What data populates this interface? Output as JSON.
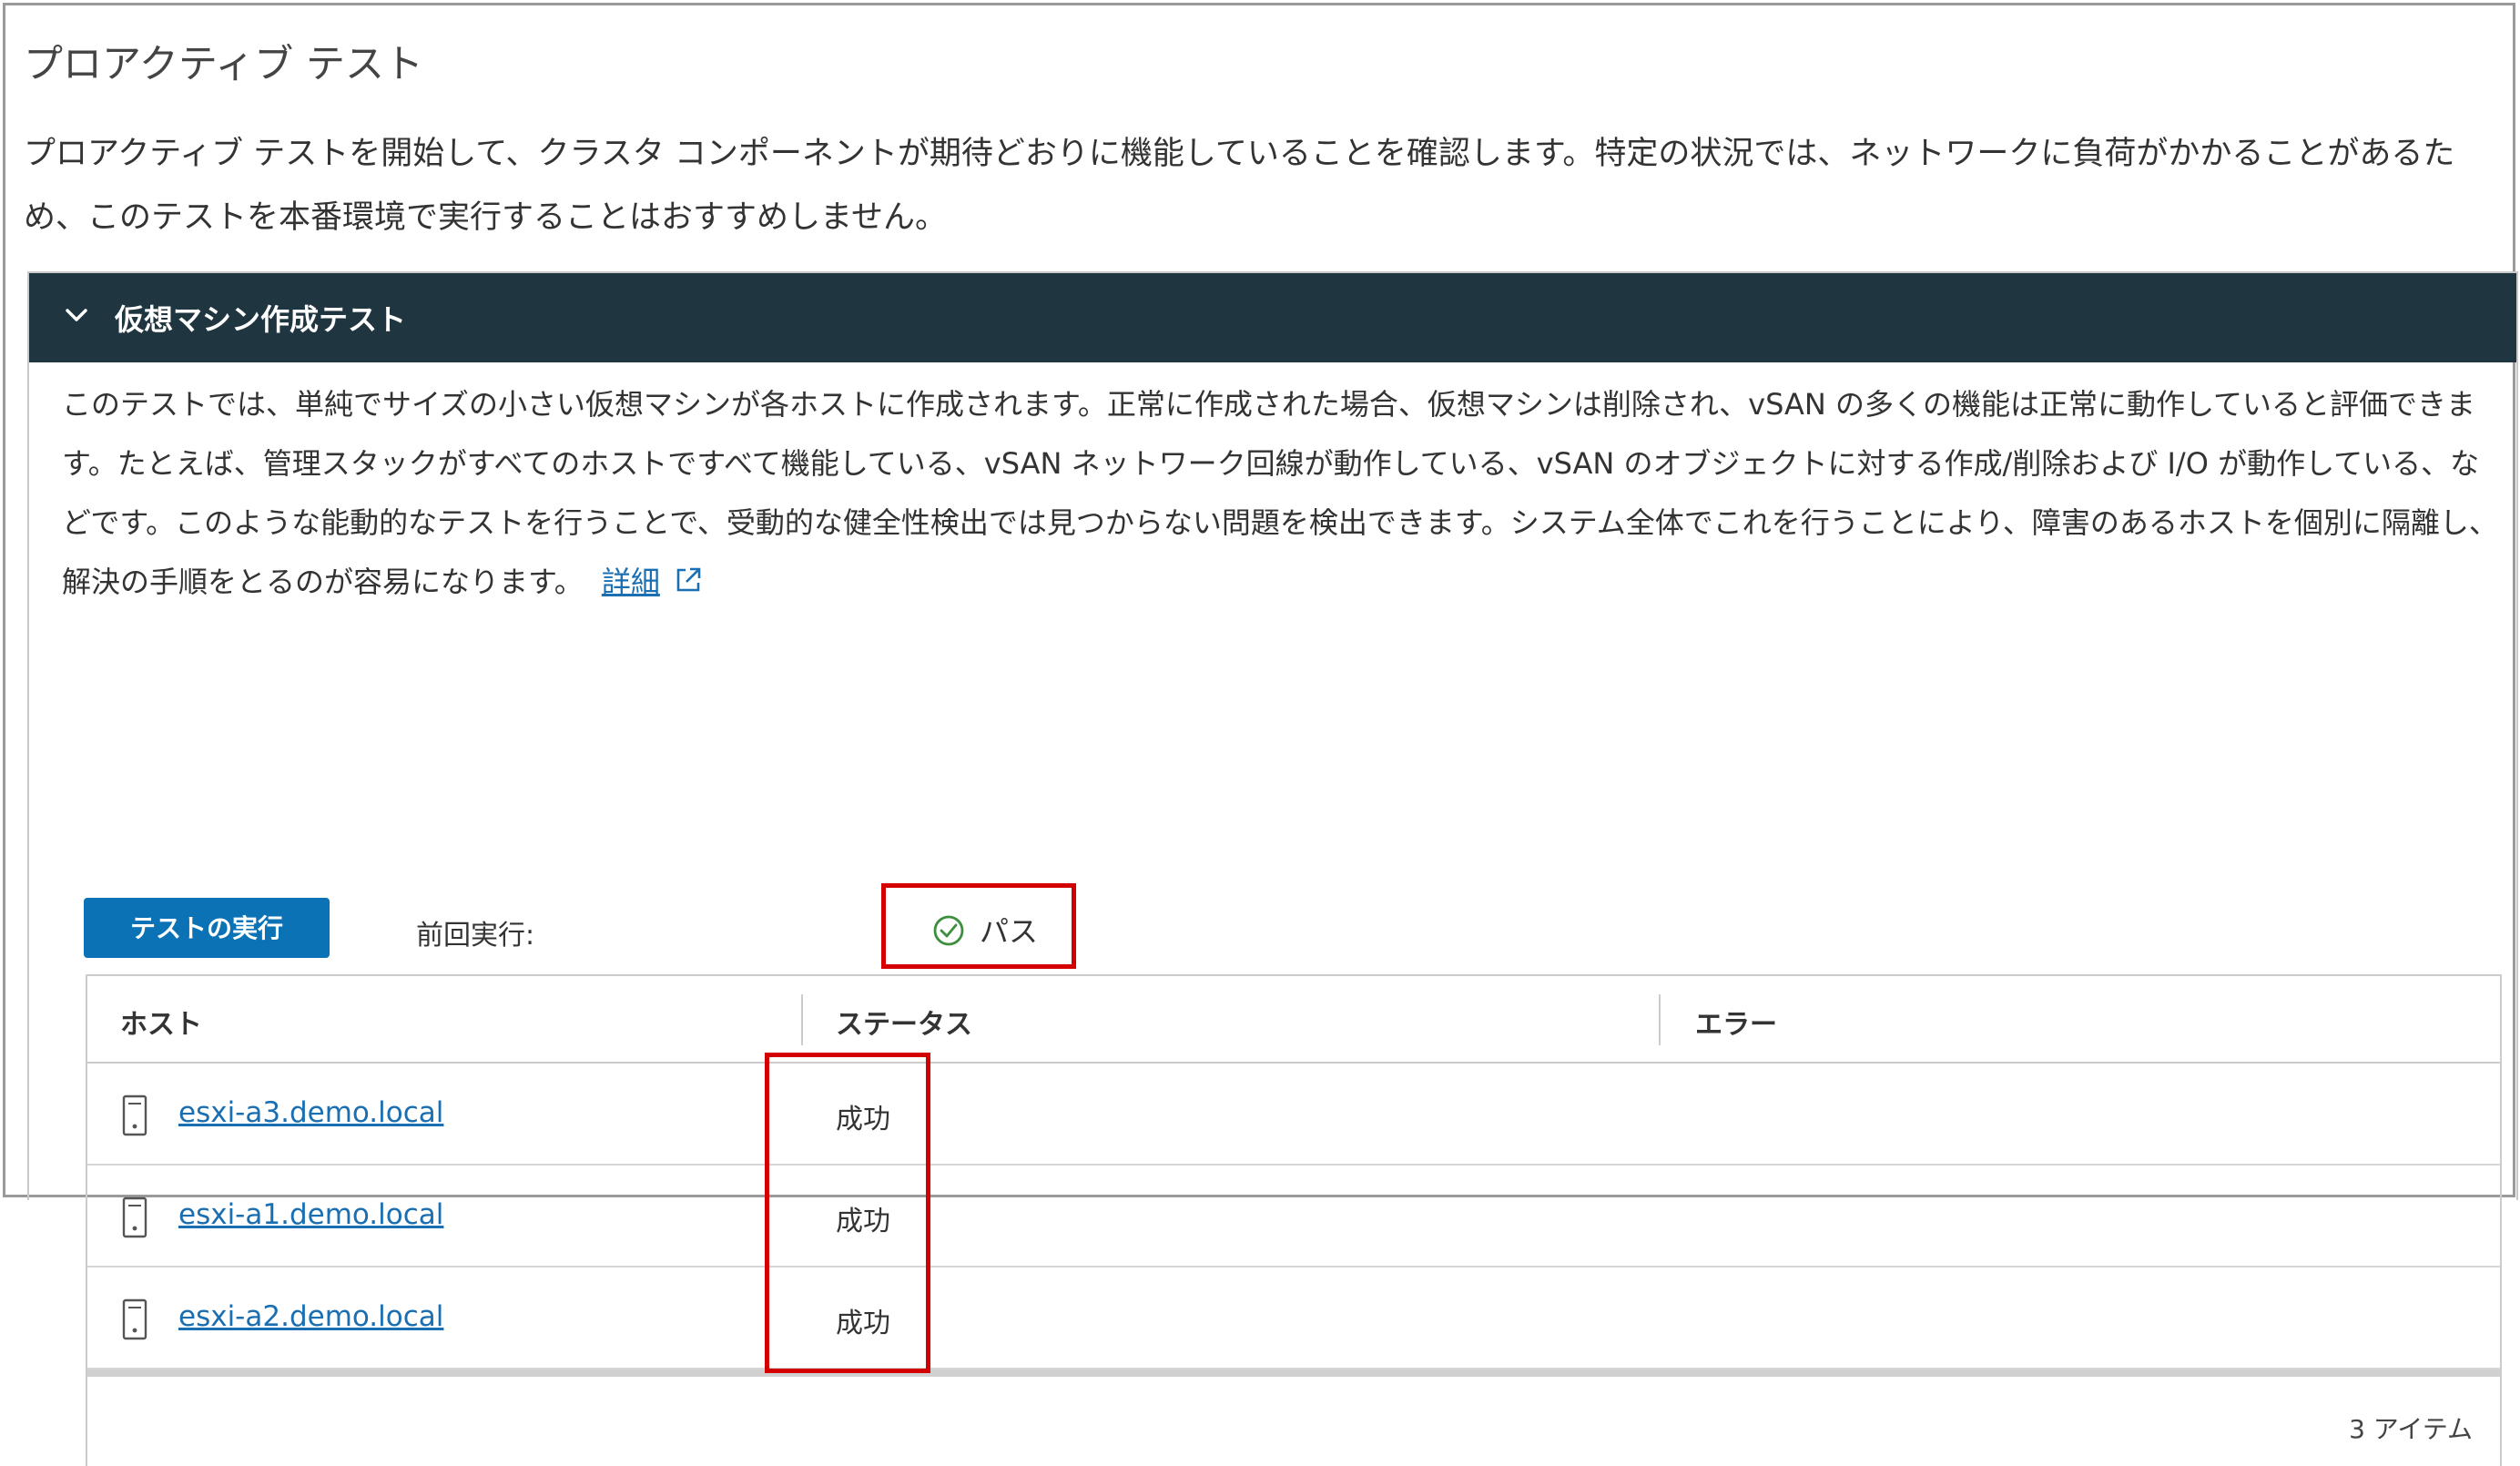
{
  "page": {
    "title": "プロアクティブ テスト",
    "description": "プロアクティブ テストを開始して、クラスタ コンポーネントが期待どおりに機能していることを確認します。特定の状況では、ネットワークに負荷がかかることがあるため、このテストを本番環境で実行することはおすすめしません。"
  },
  "section": {
    "title": "仮想マシン作成テスト",
    "expanded": true,
    "description": "このテストでは、単純でサイズの小さい仮想マシンが各ホストに作成されます。正常に作成された場合、仮想マシンは削除され、vSAN の多くの機能は正常に動作していると評価できます。たとえば、管理スタックがすべてのホストですべて機能している、vSAN ネットワーク回線が動作している、vSAN のオブジェクトに対する作成/削除および I/O が動作している、などです。このような能動的なテストを行うことで、受動的な健全性検出では見つからない問題を検出できます。システム全体でこれを行うことにより、障害のあるホストを個別に隔離し、解決の手順をとるのが容易になります。",
    "detail_link": "詳細",
    "run_button": "テストの実行",
    "last_run_label": "前回実行:",
    "last_run_status": "パス",
    "status_color": "#3c8f3c"
  },
  "grid": {
    "columns": [
      "ホスト",
      "ステータス",
      "エラー"
    ],
    "rows": [
      {
        "host": "esxi-a3.demo.local",
        "status": "成功",
        "error": ""
      },
      {
        "host": "esxi-a1.demo.local",
        "status": "成功",
        "error": ""
      },
      {
        "host": "esxi-a2.demo.local",
        "status": "成功",
        "error": ""
      }
    ],
    "footer": "3 アイテム"
  },
  "colors": {
    "header_bg": "#1f3540",
    "accent": "#0a72b5",
    "link": "#1a6fb2",
    "highlight": "#d40000"
  }
}
